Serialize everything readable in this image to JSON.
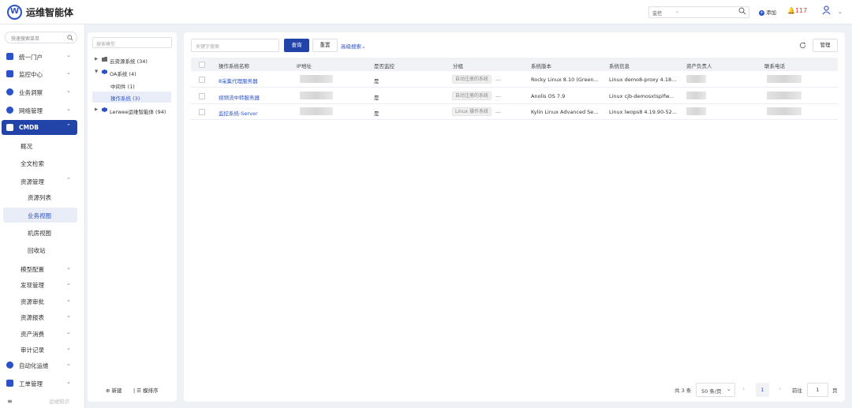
{
  "app": {
    "title": "运维智能体"
  },
  "header": {
    "select_value": "监控",
    "add_label": "添加",
    "alarm_count": "117"
  },
  "sidebar": {
    "search_placeholder": "快速搜索菜单",
    "items": [
      {
        "label": "统一门户"
      },
      {
        "label": "监控中心"
      },
      {
        "label": "业务洞察"
      },
      {
        "label": "网络管理"
      },
      {
        "label": "CMDB"
      }
    ],
    "cmdb_children": [
      {
        "label": "概况"
      },
      {
        "label": "全文检索"
      },
      {
        "label": "资源管理"
      },
      {
        "label": "资源列表"
      },
      {
        "label": "业务视图"
      },
      {
        "label": "机房视图"
      },
      {
        "label": "回收站"
      },
      {
        "label": "模型配置"
      },
      {
        "label": "发现管理"
      },
      {
        "label": "资源审批"
      },
      {
        "label": "资源报表"
      },
      {
        "label": "资产消费"
      },
      {
        "label": "审计记录"
      }
    ],
    "bottom_items": [
      {
        "label": "自动化运维"
      },
      {
        "label": "工单管理"
      }
    ],
    "footer_label": "运维知识"
  },
  "tree": {
    "search_placeholder": "搜索模型",
    "nodes": [
      {
        "label": "云资源系统 (34)"
      },
      {
        "label": "OA系统 (4)"
      },
      {
        "label": "中间件 (1)"
      },
      {
        "label": "操作系统 (3)"
      },
      {
        "label": "Lerwee运维智能体 (94)"
      }
    ],
    "footer_new": "新建",
    "footer_sort": "模排序"
  },
  "toolbar": {
    "keyword_placeholder": "关键字搜索",
    "query_label": "查询",
    "reset_label": "重置",
    "advanced_label": "高级搜索",
    "manage_label": "管理"
  },
  "table": {
    "headers": [
      "操作系统名称",
      "IP地址",
      "是否监控",
      "分组",
      "系统版本",
      "系统信息",
      "资产负责人",
      "联系电话"
    ],
    "rows": [
      {
        "name": "8采集代理服务器",
        "monitored": "是",
        "group": "自动注册的系统",
        "version": "Rocky Linux 8.10 (Green...",
        "info": "Linux demo8-proxy 4.18..."
      },
      {
        "name": "视频流中转服务器",
        "monitored": "是",
        "group": "自动注册的系统",
        "version": "Anolis OS 7.9",
        "info": "Linux cjb-demosxtsplfw..."
      },
      {
        "name": "监控系统-Server",
        "monitored": "是",
        "group": "Linux 操作系统",
        "version": "Kylin Linux Advanced Se...",
        "info": "Linux lwops8 4.19.90-52..."
      }
    ]
  },
  "pagination": {
    "total": "共 3 条",
    "page_size": "50 条/页",
    "current": "1",
    "goto_label": "前往",
    "goto_value": "1",
    "page_suffix": "页"
  }
}
